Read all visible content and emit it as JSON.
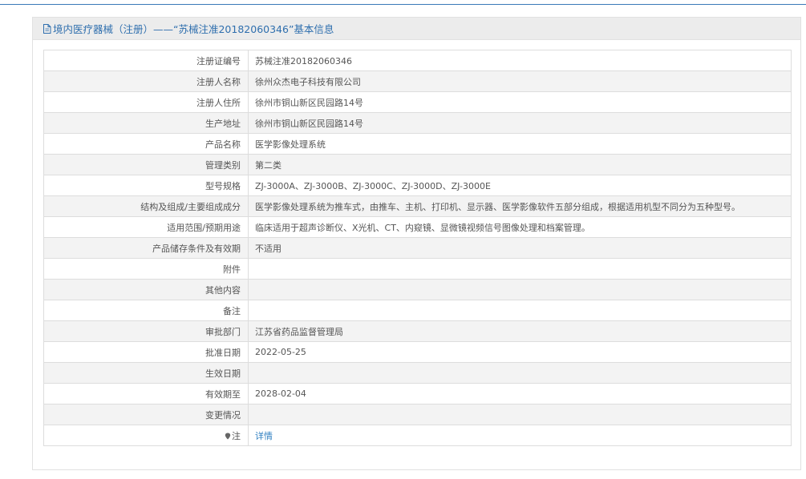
{
  "header": {
    "title": "境内医疗器械（注册）——“苏械注准20182060346”基本信息"
  },
  "rows": [
    {
      "label": "注册证编号",
      "value": "苏械注准20182060346"
    },
    {
      "label": "注册人名称",
      "value": "徐州众杰电子科技有限公司"
    },
    {
      "label": "注册人住所",
      "value": "徐州市铜山新区民园路14号"
    },
    {
      "label": "生产地址",
      "value": "徐州市铜山新区民园路14号"
    },
    {
      "label": "产品名称",
      "value": "医学影像处理系统"
    },
    {
      "label": "管理类别",
      "value": "第二类"
    },
    {
      "label": "型号规格",
      "value": "ZJ-3000A、ZJ-3000B、ZJ-3000C、ZJ-3000D、ZJ-3000E"
    },
    {
      "label": "结构及组成/主要组成成分",
      "value": "医学影像处理系统为推车式，由推车、主机、打印机、显示器、医学影像软件五部分组成，根据适用机型不同分为五种型号。"
    },
    {
      "label": "适用范围/预期用途",
      "value": "临床适用于超声诊断仪、X光机、CT、内窥镜、显微镜视频信号图像处理和档案管理。"
    },
    {
      "label": "产品储存条件及有效期",
      "value": "不适用"
    },
    {
      "label": "附件",
      "value": ""
    },
    {
      "label": "其他内容",
      "value": ""
    },
    {
      "label": "备注",
      "value": ""
    },
    {
      "label": "审批部门",
      "value": "江苏省药品监督管理局"
    },
    {
      "label": "批准日期",
      "value": "2022-05-25"
    },
    {
      "label": "生效日期",
      "value": ""
    },
    {
      "label": "有效期至",
      "value": "2028-02-04"
    },
    {
      "label": "变更情况",
      "value": ""
    }
  ],
  "note_row": {
    "icon": "pin-icon",
    "label": "注",
    "link_text": "详情"
  },
  "colors": {
    "accent": "#2f6fae",
    "link": "#2f7fc1",
    "header_bg": "#ececec",
    "stripe_bg": "#f3f3f3"
  }
}
